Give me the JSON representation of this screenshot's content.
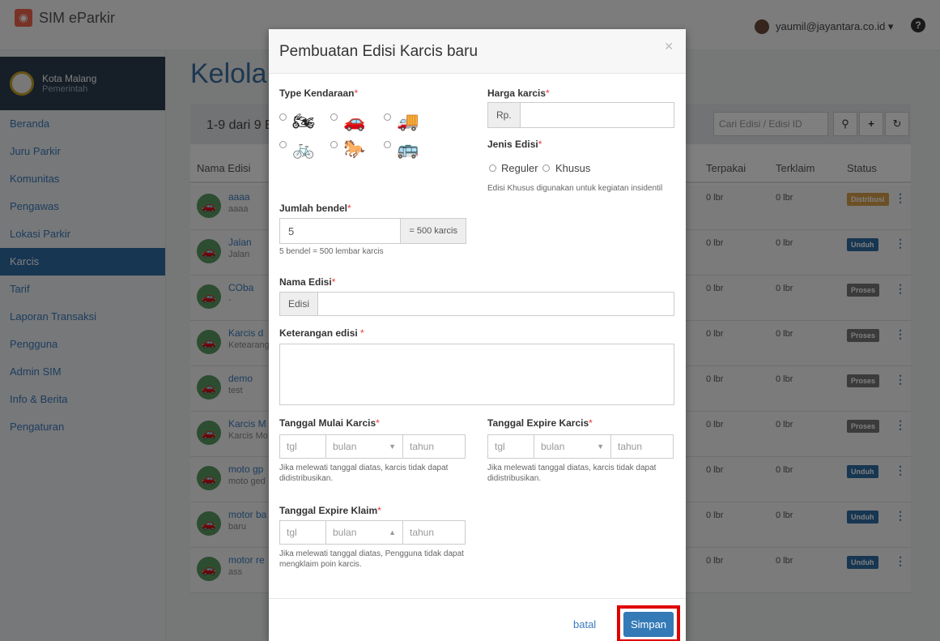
{
  "app": {
    "title": "SIM eParkir",
    "user": "yaumil@jayantara.co.id ▾"
  },
  "sidebar": {
    "org_name": "Kota Malang",
    "org_sub": "Pemerintah",
    "items": [
      "Beranda",
      "Juru Parkir",
      "Komunitas",
      "Pengawas",
      "Lokasi Parkir",
      "Karcis",
      "Tarif",
      "Laporan Transaksi",
      "Pengguna",
      "Admin SIM",
      "Info & Berita",
      "Pengaturan"
    ],
    "active_index": 5
  },
  "page": {
    "title": "Kelola",
    "count_text": "1-9 dari 9 E",
    "search_placeholder": "Cari Edisi / Edisi ID",
    "columns": {
      "name": "Nama Edisi",
      "terpakai": "Terpakai",
      "terklaim": "Terklaim",
      "status": "Status"
    },
    "rows": [
      {
        "name": "aaaa",
        "sub": "aaaa",
        "terpakai": "0 lbr",
        "terklaim": "0 lbr",
        "status": "Distribusi",
        "color": "#d9a04a"
      },
      {
        "name": "Jalan",
        "sub": "Jalan",
        "terpakai": "0 lbr",
        "terklaim": "0 lbr",
        "status": "Unduh",
        "color": "#2e6da4"
      },
      {
        "name": "COba",
        "sub": "-",
        "terpakai": "0 lbr",
        "terklaim": "0 lbr",
        "status": "Proses",
        "color": "#777"
      },
      {
        "name": "Karcis d",
        "sub": "Ketearang",
        "terpakai": "0 lbr",
        "terklaim": "0 lbr",
        "status": "Proses",
        "color": "#777"
      },
      {
        "name": "demo",
        "sub": "test",
        "terpakai": "0 lbr",
        "terklaim": "0 lbr",
        "status": "Proses",
        "color": "#777"
      },
      {
        "name": "Karcis M",
        "sub": "Karcis Mo",
        "terpakai": "0 lbr",
        "terklaim": "0 lbr",
        "status": "Proses",
        "color": "#777"
      },
      {
        "name": "moto gp",
        "sub": "moto ged",
        "terpakai": "0 lbr",
        "terklaim": "0 lbr",
        "status": "Unduh",
        "color": "#2e6da4"
      },
      {
        "name": "motor ba",
        "sub": "baru",
        "terpakai": "0 lbr",
        "terklaim": "0 lbr",
        "status": "Unduh",
        "color": "#2e6da4"
      },
      {
        "name": "motor re",
        "sub": "ass",
        "terpakai": "0 lbr",
        "terklaim": "0 lbr",
        "status": "Unduh",
        "color": "#2e6da4"
      }
    ]
  },
  "modal": {
    "title": "Pembuatan Edisi Karcis baru",
    "type_label": "Type Kendaraan",
    "harga_label": "Harga karcis",
    "harga_prefix": "Rp.",
    "jenis_label": "Jenis Edisi",
    "jenis_options": [
      "Reguler",
      "Khusus"
    ],
    "jenis_hint": "Edisi Khusus digunakan untuk kegiatan insidentil",
    "bendel_label": "Jumlah bendel",
    "bendel_value": "5",
    "bendel_suffix": "= 500 karcis",
    "bendel_hint": "5 bendel = 500 lembar karcis",
    "nama_label": "Nama Edisi",
    "nama_prefix": "Edisi",
    "ket_label": "Keterangan edisi",
    "mulai_label": "Tanggal Mulai Karcis",
    "expire_label": "Tanggal Expire Karcis",
    "klaim_label": "Tanggal Expire Klaim",
    "date_tgl": "tgl",
    "date_bulan": "bulan",
    "date_tahun": "tahun",
    "dist_hint": "Jika melewati tanggal diatas, karcis tidak dapat didistribusikan.",
    "klaim_hint": "Jika melewati tanggal diatas, Pengguna tidak dapat mengklaim poin karcis.",
    "batal": "batal",
    "simpan": "Simpan",
    "required_mark": "*"
  }
}
